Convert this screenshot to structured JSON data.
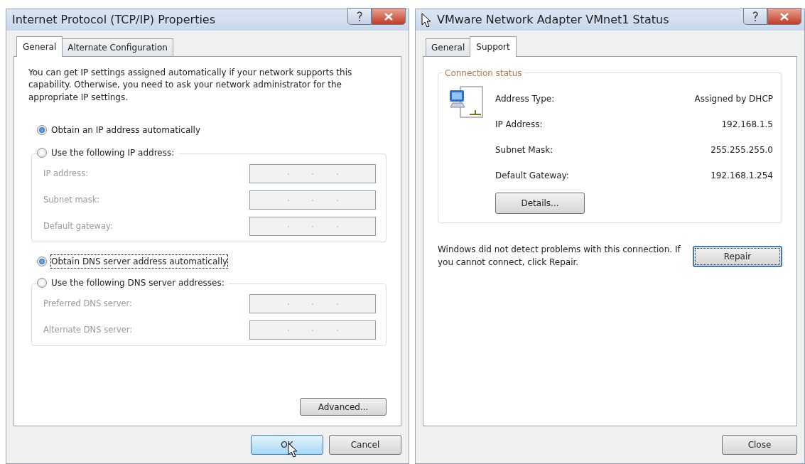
{
  "tcpip_dialog": {
    "title": "Internet Protocol (TCP/IP) Properties",
    "tabs": [
      {
        "label": "General",
        "selected": true
      },
      {
        "label": "Alternate Configuration",
        "selected": false
      }
    ],
    "intro": "You can get IP settings assigned automatically if your network supports this capability. Otherwise, you need to ask your network administrator for the appropriate IP settings.",
    "ip_options": [
      {
        "label": "Obtain an IP address automatically",
        "selected": true,
        "focused": false
      },
      {
        "label": "Use the following IP address:",
        "selected": false,
        "focused": false
      }
    ],
    "ip_fields": [
      {
        "label": "IP address:",
        "disabled": true
      },
      {
        "label": "Subnet mask:",
        "disabled": true
      },
      {
        "label": "Default gateway:",
        "disabled": true
      }
    ],
    "dns_options": [
      {
        "label": "Obtain DNS server address automatically",
        "selected": true,
        "focused": true
      },
      {
        "label": "Use the following DNS server addresses:",
        "selected": false,
        "focused": false
      }
    ],
    "dns_fields": [
      {
        "label": "Preferred DNS server:",
        "disabled": true
      },
      {
        "label": "Alternate DNS server:",
        "disabled": true
      }
    ],
    "advanced_button": "Advanced...",
    "buttons": [
      {
        "label": "OK",
        "default": true
      },
      {
        "label": "Cancel",
        "default": false
      }
    ]
  },
  "status_dialog": {
    "title": "VMware Network Adapter VMnet1 Status",
    "tabs": [
      {
        "label": "General",
        "selected": false
      },
      {
        "label": "Support",
        "selected": true
      }
    ],
    "group_title": "Connection status",
    "rows": [
      {
        "label": "Address Type:",
        "value": "Assigned by DHCP"
      },
      {
        "label": "IP Address:",
        "value": "192.168.1.5"
      },
      {
        "label": "Subnet Mask:",
        "value": "255.255.255.0"
      },
      {
        "label": "Default Gateway:",
        "value": "192.168.1.254"
      }
    ],
    "details_button": "Details...",
    "message": "Windows did not detect problems with this connection. If you cannot connect, click Repair.",
    "repair_button": {
      "label": "Repair",
      "focused": true
    },
    "close_button": "Close"
  }
}
